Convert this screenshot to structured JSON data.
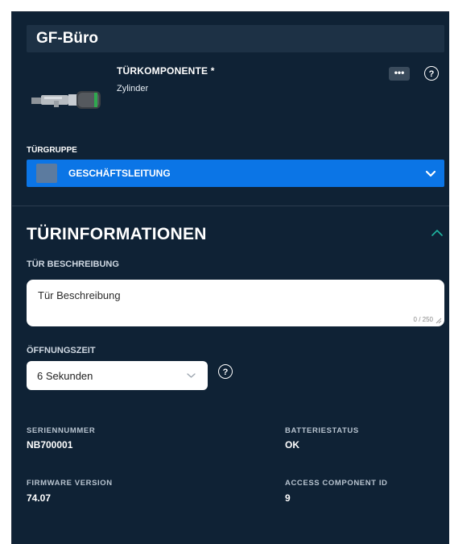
{
  "header": {
    "title": "GF-Büro"
  },
  "component": {
    "label": "TÜRKOMPONENTE *",
    "value": "Zylinder",
    "more_label": "•••",
    "help_label": "?"
  },
  "door_group": {
    "label": "TÜRGRUPPE",
    "selected": "GESCHÄFTSLEITUNG",
    "swatch_color": "#5c7b9f",
    "accent": "#0b75e6"
  },
  "door_info": {
    "title": "TÜRINFORMATIONEN",
    "description": {
      "label": "TÜR BESCHREIBUNG",
      "value": "Tür Beschreibung",
      "counter": "0 / 250"
    },
    "opening_time": {
      "label": "ÖFFNUNGSZEIT",
      "selected": "6 Sekunden",
      "help_label": "?"
    },
    "fields": [
      {
        "label": "SERIENNUMMER",
        "value": "NB700001"
      },
      {
        "label": "BATTERIESTATUS",
        "value": "OK"
      },
      {
        "label": "FIRMWARE VERSION",
        "value": "74.07"
      },
      {
        "label": "ACCESS COMPONENT ID",
        "value": "9"
      }
    ]
  }
}
